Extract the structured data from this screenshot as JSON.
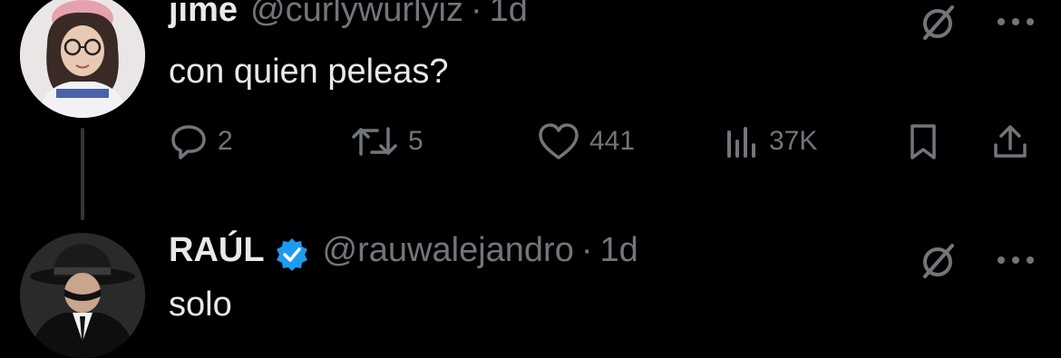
{
  "tweets": [
    {
      "name": "jime",
      "handle": "@curlywurlyiz",
      "separator": "·",
      "time": "1d",
      "text": "con quien peleas?",
      "avatar_icon": "user-avatar-girl-glasses",
      "stats": {
        "replies": "2",
        "retweets": "5",
        "likes": "441",
        "views": "37K"
      }
    },
    {
      "name": "RAÚL",
      "verified": true,
      "handle": "@rauwalejandro",
      "separator": "·",
      "time": "1d",
      "text": "solo",
      "avatar_icon": "user-avatar-man-fedora"
    }
  ],
  "icons": {
    "grok": "grok-slash-circle-icon",
    "more": "more-dots-icon",
    "reply": "reply-bubble-icon",
    "retweet": "retweet-icon",
    "like": "heart-icon",
    "views": "views-bar-chart-icon",
    "bookmark": "bookmark-icon",
    "share": "share-upload-icon",
    "verified": "verified-badge-icon"
  },
  "colors": {
    "background": "#000000",
    "primary_text": "#e7e9ea",
    "secondary_text": "#71767b",
    "verified": "#1d9bf0",
    "thread_line": "#333639"
  }
}
